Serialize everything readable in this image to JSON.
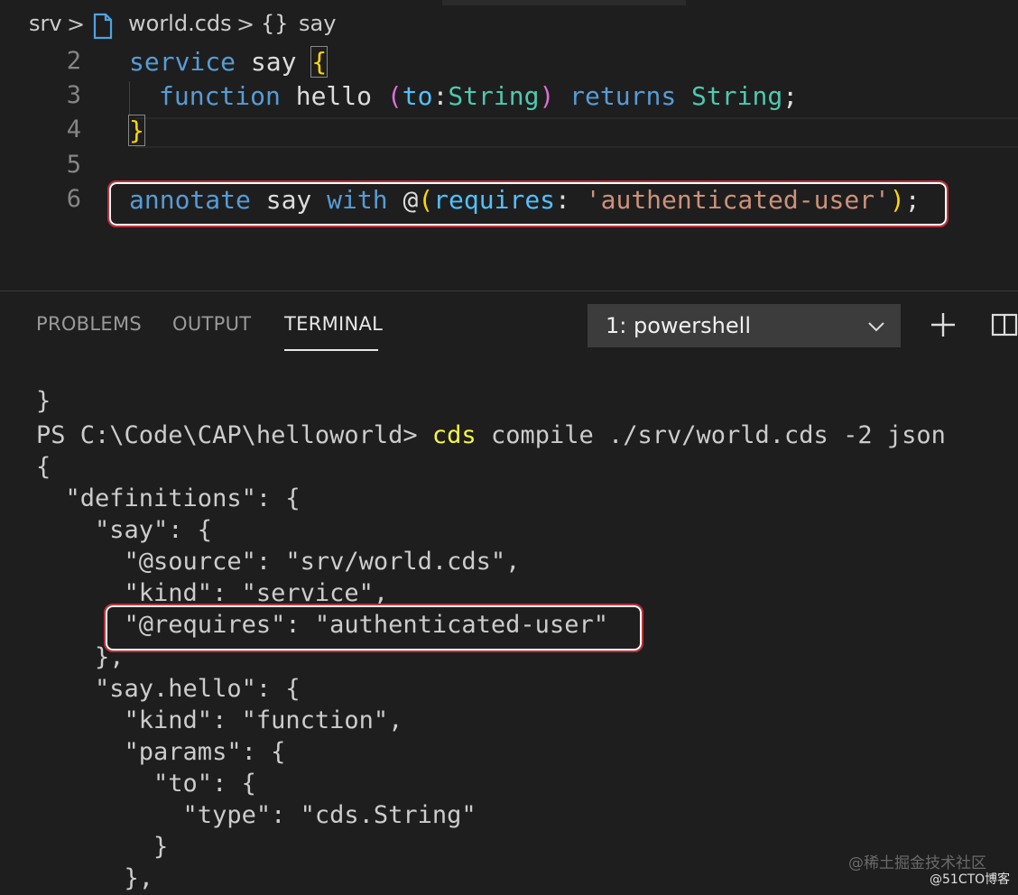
{
  "breadcrumb": {
    "folder": "srv",
    "file": "world.cds",
    "symbol_icon": "{}",
    "symbol": "say",
    "separator": ">"
  },
  "editor": {
    "lines": [
      {
        "num": "2",
        "t1": "service",
        "t2": " say ",
        "t3": "{"
      },
      {
        "num": "3",
        "t1": "function",
        "t2": " hello ",
        "t3": "(",
        "t4": "to",
        "t5": ":",
        "t6": "String",
        "t7": ")",
        "t8": " returns ",
        "t9": "String",
        "t10": ";"
      },
      {
        "num": "4",
        "t1": "}"
      },
      {
        "num": "5"
      },
      {
        "num": "6",
        "t1": "annotate",
        "t2": " say ",
        "t3": "with",
        "t4": " @",
        "t5": "(",
        "t6": "requires",
        "t7": ": ",
        "t8": "'authenticated-user'",
        "t9": ")",
        "t10": ";"
      }
    ]
  },
  "panel": {
    "tabs": [
      "PROBLEMS",
      "OUTPUT",
      "TERMINAL"
    ],
    "active_tab": "TERMINAL",
    "terminal_select": "1: powershell",
    "icons": {
      "new": "plus-icon",
      "split": "split-terminal-icon",
      "dropdown": "chevron-down-icon"
    }
  },
  "terminal": {
    "prompt": "PS C:\\Code\\CAP\\helloworld> ",
    "command": "cds",
    "args": " compile ./srv/world.cds -2 json",
    "lines": [
      "}",
      "",
      "{",
      "  \"definitions\": {",
      "    \"say\": {",
      "      \"@source\": \"srv/world.cds\",",
      "      \"kind\": \"service\",",
      "      \"@requires\": \"authenticated-user\"",
      "    },",
      "    \"say.hello\": {",
      "      \"kind\": \"function\",",
      "      \"params\": {",
      "        \"to\": {",
      "          \"type\": \"cds.String\"",
      "        }",
      "      },"
    ]
  },
  "watermark": {
    "line1": "@稀土掘金技术社区",
    "line2": "@51CTO博客"
  },
  "colors": {
    "highlight_box": "#c0303a",
    "keyword": "#569cd6",
    "type": "#4ec9b0",
    "string": "#ce9178",
    "bracket": "#ffd700"
  }
}
